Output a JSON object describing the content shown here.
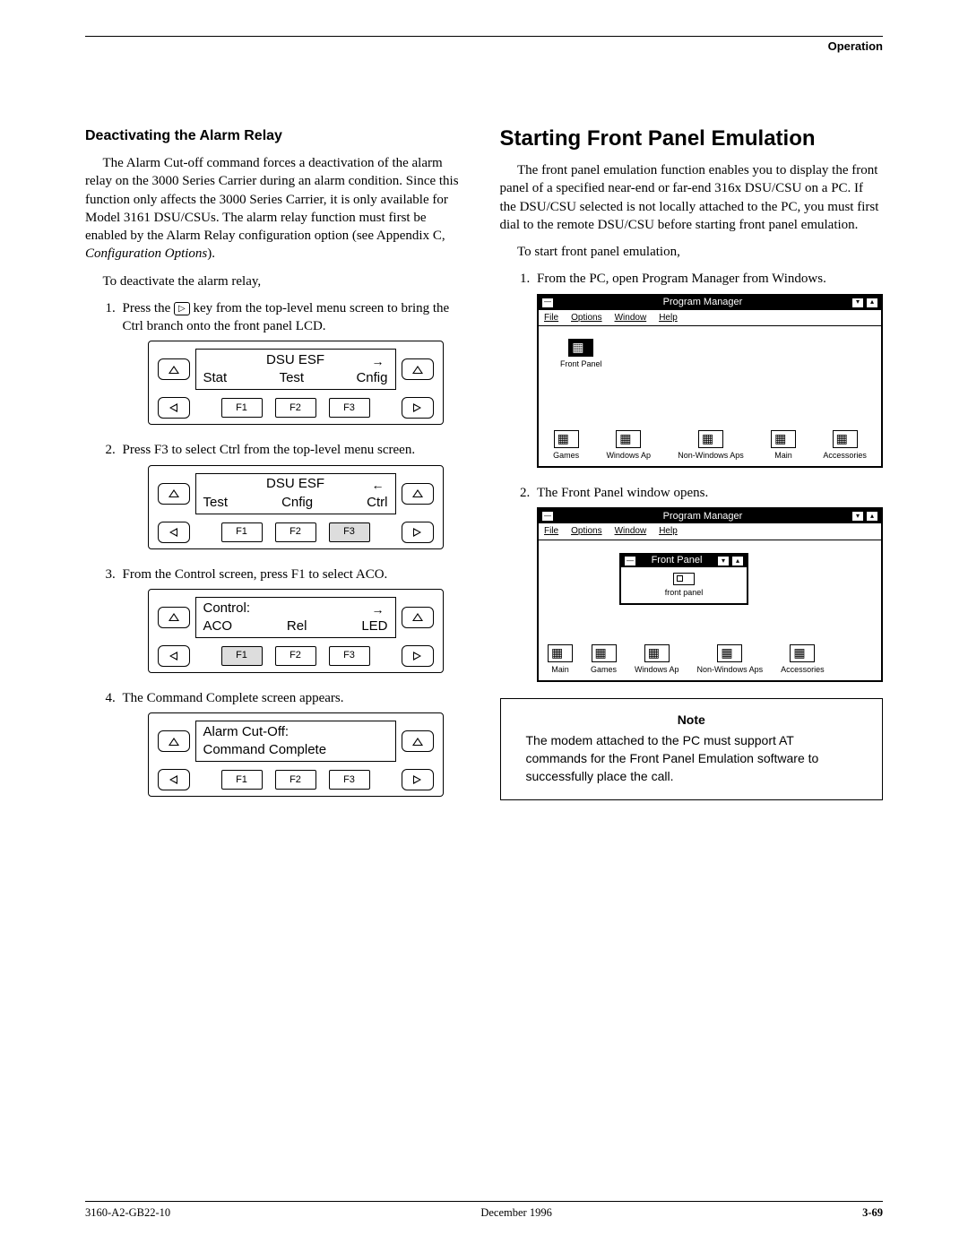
{
  "header": {
    "section": "Operation"
  },
  "left": {
    "title": "Deactivating the Alarm Relay",
    "para1a": "The Alarm Cut-off command forces a deactivation of the alarm relay on the 3000 Series Carrier during an alarm condition. Since this function only affects the 3000 Series Carrier, it is only available for Model 3161 DSU/CSUs. The alarm relay function must first be enabled by the Alarm Relay configuration option (see Appendix C, ",
    "para1b": "Configuration Options",
    "para1c": ").",
    "para2": "To deactivate the alarm relay,",
    "step1a": "Press the ",
    "step1b": " key from the top-level menu screen to bring the Ctrl branch onto the front panel LCD.",
    "lcd1": {
      "hdr": "DSU ESF",
      "arrow": "→",
      "l1": "Stat",
      "l2": "Test",
      "l3": "Cnfig",
      "f1": "F1",
      "f2": "F2",
      "f3": "F3"
    },
    "step2": "Press F3 to select Ctrl from the top-level menu screen.",
    "lcd2": {
      "hdr": "DSU ESF",
      "arrow": "←",
      "l1": "Test",
      "l2": "Cnfig",
      "l3": "Ctrl",
      "f1": "F1",
      "f2": "F2",
      "f3": "F3"
    },
    "step3": "From the Control screen, press F1 to select ACO.",
    "lcd3": {
      "hdr": "Control:",
      "arrow": "→",
      "l1": "ACO",
      "l2": "Rel",
      "l3": "LED",
      "f1": "F1",
      "f2": "F2",
      "f3": "F3"
    },
    "step4": "The Command Complete screen appears.",
    "lcd4": {
      "hdr": "Alarm Cut-Off:",
      "arrow": "",
      "row2": "Command Complete",
      "f1": "F1",
      "f2": "F2",
      "f3": "F3"
    }
  },
  "right": {
    "h1": "Starting Front Panel Emulation",
    "para1": "The front panel emulation function enables you to display the front panel of a specified near-end or far-end 316x DSU/CSU on a PC. If the DSU/CSU selected is not locally attached to the PC, you must first dial to the remote DSU/CSU before starting front panel emulation.",
    "para2": "To start front panel emulation,",
    "step1": "From the PC, open Program Manager from Windows.",
    "pm": {
      "title": "Program Manager",
      "menu": {
        "file": "File",
        "options": "Options",
        "window": "Window",
        "help": "Help"
      },
      "fp_icon_label": "Front Panel",
      "icons": {
        "games": "Games",
        "wa": "Windows Ap",
        "nwa": "Non-Windows Aps",
        "main": "Main",
        "acc": "Accessories"
      }
    },
    "step2": "The Front Panel window opens.",
    "pm2": {
      "title": "Program Manager",
      "sub_title": "Front Panel",
      "sub_label": "front panel",
      "icons": {
        "main": "Main",
        "games": "Games",
        "wa": "Windows Ap",
        "nwa": "Non-Windows Aps",
        "acc": "Accessories"
      }
    },
    "note": {
      "title": "Note",
      "body": "The modem attached to the PC must support AT commands for the Front Panel Emulation software to successfully place the call."
    }
  },
  "footer": {
    "left": "3160-A2-GB22-10",
    "center": "December 1996",
    "right": "3-69"
  }
}
